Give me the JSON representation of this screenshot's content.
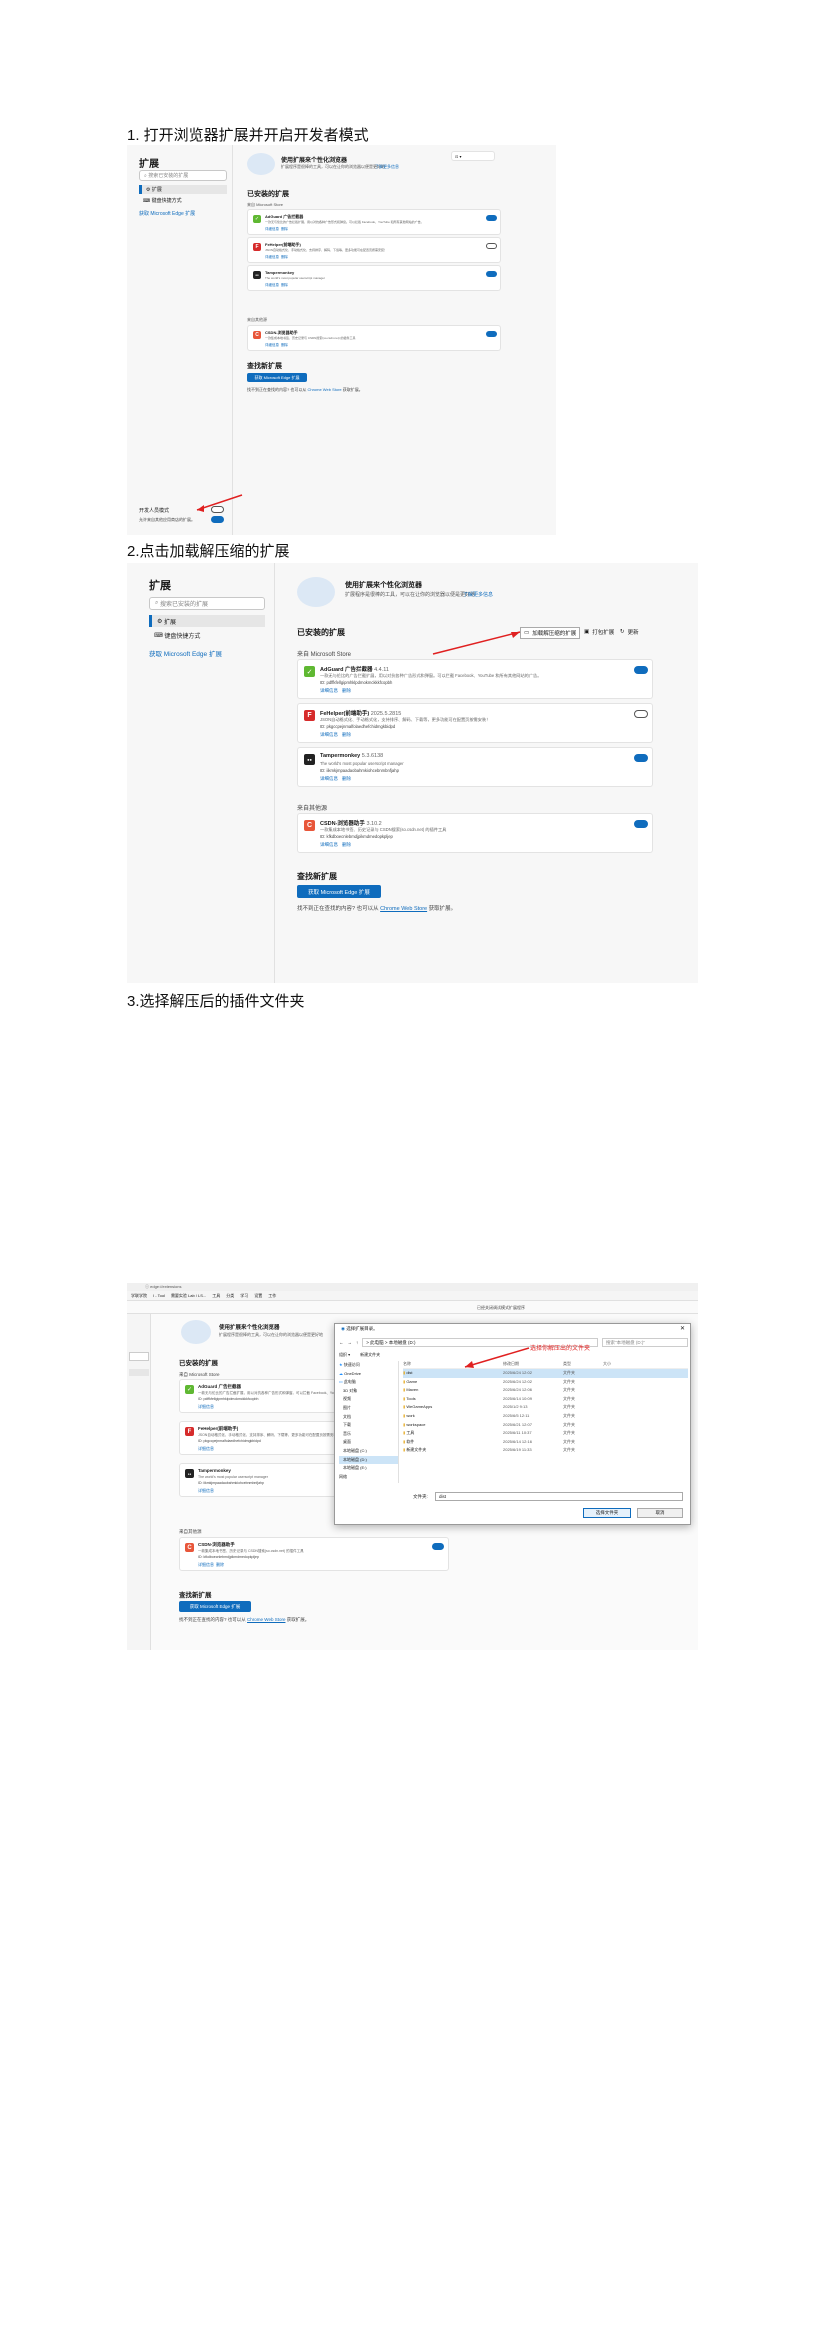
{
  "steps": [
    {
      "title": "1.  打开浏览器扩展并开启开发者模式"
    },
    {
      "title": "2.点击加载解压缩的扩展"
    },
    {
      "title": "3.选择解压后的插件文件夹"
    }
  ],
  "common": {
    "sidebar_title": "扩展",
    "search_placeholder": "搜索已安装的扩展",
    "nav_extensions": "扩展",
    "nav_shortcuts": "键盘快捷方式",
    "get_edge_link": "获取 Microsoft Edge 扩展",
    "hero_title": "使用扩展来个性化浏览器",
    "hero_desc": "扩展程序是很棒的工具，可以在让你的浏览器以便是更好地",
    "hero_learn_more": "了解更多信息",
    "installed_heading": "已安装的扩展",
    "from_store": "来自 Microsoft Store",
    "from_other": "来自其他源",
    "load_unpacked": "加载解压缩的扩展",
    "pack": "打包扩展",
    "update": "更新",
    "find_heading": "查找新扩展",
    "get_ext_button": "获取 Microsoft Edge 扩展",
    "find_text_pre": "找不到正在查找的内容? 也可以从",
    "chrome_store": "Chrome Web Store",
    "find_text_post": "获取扩展。",
    "details": "详细信息",
    "remove": "删除",
    "dev_mode": "开发人员模式",
    "allow_other": "允许来自其他应用商店的扩展。"
  },
  "extensions": [
    {
      "name": "AdGuard 广告拦截器",
      "version": "4.4.11",
      "desc": "一款无与伦比的广告拦截扩展，用以对抗各种广告形式和弹窗。可以拦截 Facebook、YouTube 和所有其他网站的广告。",
      "id": "ID: pdffkfellgipmhklpdmokmckkkfcopbh",
      "icon_color": "#5fb832",
      "icon_glyph": "✓",
      "enabled": true
    },
    {
      "name": "FeHelper(前端助手)",
      "version": "2025.5.2815",
      "desc": "JSON自动格式化、手动格式化，支持排序、解码、下载等，更多功能可在配置页按需安装！",
      "id": "ID: pkgccpejnmalfolaedhefchidmgkbidpd",
      "icon_color": "#d62b2b",
      "icon_glyph": "F",
      "enabled": false
    },
    {
      "name": "Tampermonkey",
      "version": "5.3.6138",
      "desc": "The world's most popular userscript manager",
      "id": "ID: iikmkjmpaadaobahmkiohcebnmbnfjahp",
      "icon_color": "#222222",
      "icon_glyph": "●●",
      "enabled": true
    },
    {
      "name": "CSDN-浏览器助手",
      "version": "3.10.2",
      "desc": "一款集成本地书签、历史记录与 CSDN搜索(so.csdn.net) 的插件工具",
      "id": "ID: kfkdboecnlebmdjpikmdmedopkpljep",
      "icon_color": "#e8563a",
      "icon_glyph": "C",
      "enabled": true
    }
  ],
  "step3": {
    "address": "edge://extensions",
    "bookmarks": [
      "学联学院",
      "I - Tool",
      "需要实验 Lab / LS...",
      "工具",
      "分类",
      "学习",
      "设置",
      "工作"
    ],
    "notice": "已经关闭调试模式扩展程序",
    "annotation": "选择你解压出的文件夹",
    "dialog": {
      "title": "选择扩展目录。",
      "path": "> 此电脑 > 本地磁盘 (D:)",
      "search_placeholder": "搜索\"本地磁盘 (D:)\"",
      "toolbar_organize": "组织 ▾",
      "toolbar_new": "新建文件夹",
      "columns": [
        "名称",
        "修改日期",
        "类型",
        "大小"
      ],
      "tree": [
        "快速访问",
        "OneDrive",
        "此电脑",
        "3D 对象",
        "视频",
        "图片",
        "文档",
        "下载",
        "音乐",
        "桌面",
        "本地磁盘 (C:)",
        "本地磁盘 (D:)",
        "本地磁盘 (E:)",
        "网络"
      ],
      "rows": [
        {
          "name": "dist",
          "date": "2025/6/24 12:02",
          "type": "文件夹"
        },
        {
          "name": "Game",
          "date": "2025/6/24 12:02",
          "type": "文件夹"
        },
        {
          "name": "Maven",
          "date": "2025/6/24 12:06",
          "type": "文件夹"
        },
        {
          "name": "Tools",
          "date": "2025/6/14 10:09",
          "type": "文件夹"
        },
        {
          "name": "WeGameApps",
          "date": "2025/1/2 9:13",
          "type": "文件夹"
        },
        {
          "name": "work",
          "date": "2025/6/5 12:11",
          "type": "文件夹"
        },
        {
          "name": "workspace",
          "date": "2025/6/21 12:07",
          "type": "文件夹"
        },
        {
          "name": "工具",
          "date": "2025/6/11 10:37",
          "type": "文件夹"
        },
        {
          "name": "软件",
          "date": "2025/6/14 12:16",
          "type": "文件夹"
        },
        {
          "name": "新建文件夹",
          "date": "2025/6/19 11:33",
          "type": "文件夹"
        }
      ],
      "folder_label": "文件夹:",
      "folder_value": "dist",
      "select_btn": "选择文件夹",
      "cancel_btn": "取消"
    }
  }
}
